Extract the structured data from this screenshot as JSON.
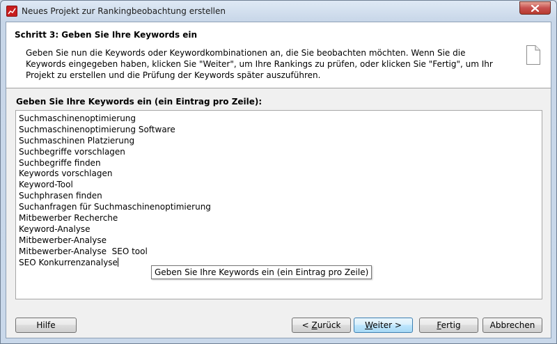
{
  "window": {
    "title": "Neues Projekt zur Rankingbeobachtung erstellen"
  },
  "header": {
    "step_title": "Schritt 3: Geben Sie Ihre Keywords ein",
    "description": "Geben Sie nun die Keywords oder Keywordkombinationen an, die Sie beobachten möchten. Wenn Sie die Keywords eingegeben haben, klicken Sie \"Weiter\", um Ihre Rankings zu prüfen, oder klicken Sie \"Fertig\", um Ihr Projekt zu erstellen und die Prüfung der Keywords später auszuführen."
  },
  "keywords": {
    "label": "Geben Sie Ihre Keywords ein (ein Eintrag pro Zeile):",
    "lines": [
      "Suchmaschinenoptimierung",
      "Suchmaschinenoptimierung Software",
      "Suchmaschinen Platzierung",
      "Suchbegriffe vorschlagen",
      "Suchbegriffe finden",
      "Keywords vorschlagen",
      "Keyword-Tool",
      "Suchphrasen finden",
      "Suchanfragen für Suchmaschinenoptimierung",
      "Mitbewerber Recherche",
      "Keyword-Analyse",
      "Mitbewerber-Analyse",
      "Mitbewerber-Analyse  SEO tool",
      "SEO Konkurrenzanalyse"
    ],
    "tooltip": "Geben Sie Ihre Keywords ein (ein Eintrag pro Zeile)"
  },
  "buttons": {
    "help": "Hilfe",
    "back_prefix": "< ",
    "back_mnemonic": "Z",
    "back_rest": "urück",
    "next_mnemonic": "W",
    "next_rest": "eiter >",
    "finish_mnemonic": "F",
    "finish_rest": "ertig",
    "cancel": "Abbrechen"
  },
  "icons": {
    "app": "app-logo-icon",
    "close": "close-icon",
    "document": "document-icon"
  }
}
